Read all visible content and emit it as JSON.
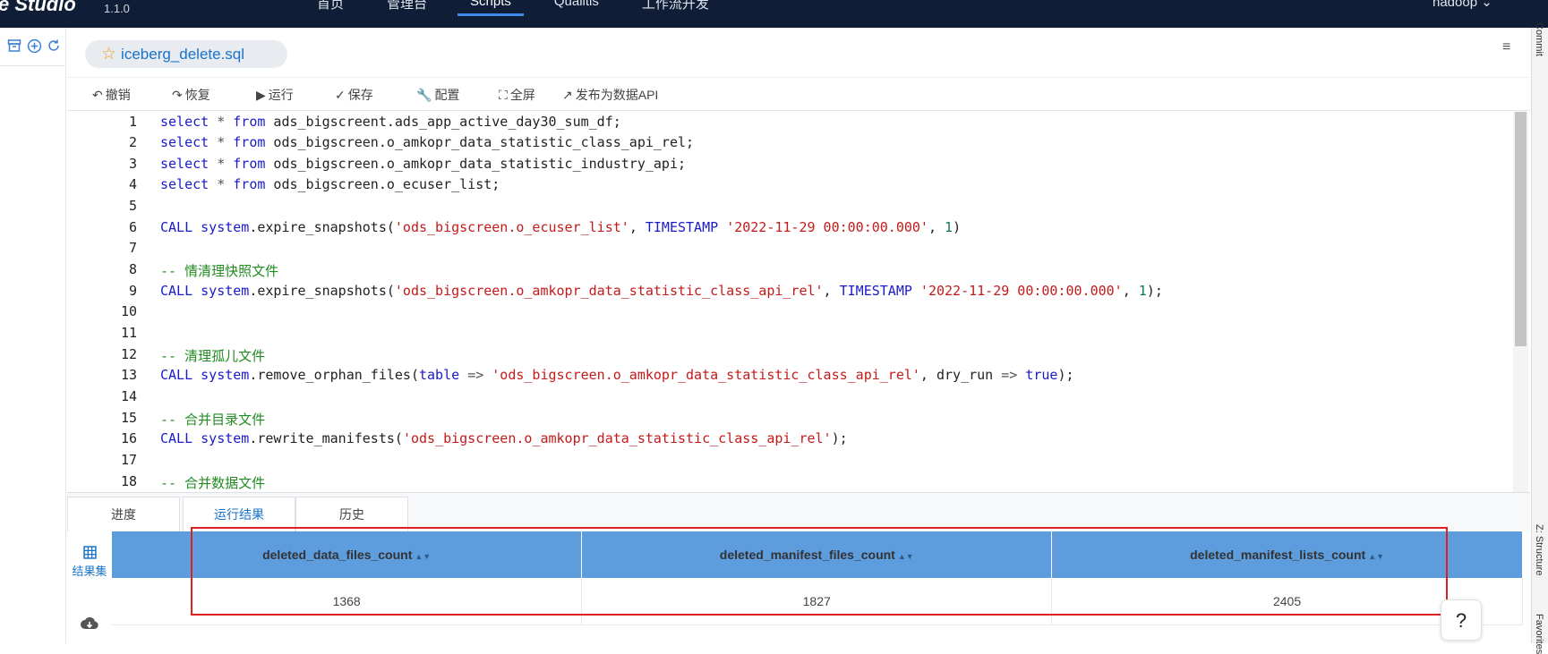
{
  "header": {
    "brand": "e Studio",
    "version": "1.1.0",
    "nav": [
      "首页",
      "管理台",
      "Scripts",
      "Qualitis",
      "工作流开发"
    ],
    "active_nav_index": 2,
    "user": "hadoop"
  },
  "left_panel": {
    "icons": [
      "archive-icon",
      "add-circle-icon",
      "refresh-icon"
    ]
  },
  "right_strip": {
    "labels": [
      "Commit",
      "Z: Structure",
      "Favorites"
    ]
  },
  "file_tab": {
    "name": "iceberg_delete.sql",
    "icon": "star-icon"
  },
  "toolbar": {
    "undo": "撤销",
    "redo": "恢复",
    "run": "运行",
    "save": "保存",
    "config": "配置",
    "fullscreen": "全屏",
    "publish": "发布为数据API"
  },
  "editor": {
    "line_numbers": [
      "1",
      "2",
      "3",
      "4",
      "5",
      "6",
      "7",
      "8",
      "9",
      "10",
      "11",
      "12",
      "13",
      "14",
      "15",
      "16",
      "17",
      "18"
    ],
    "code_lines": [
      "select * from ads_bigscreent.ads_app_active_day30_sum_df;",
      "select * from ods_bigscreen.o_amkopr_data_statistic_class_api_rel;",
      "select * from ods_bigscreen.o_amkopr_data_statistic_industry_api;",
      "select * from ods_bigscreen.o_ecuser_list;",
      "",
      "CALL system.expire_snapshots('ods_bigscreen.o_ecuser_list', TIMESTAMP '2022-11-29 00:00:00.000', 1)",
      "",
      "-- 情清理快照文件",
      "CALL system.expire_snapshots('ods_bigscreen.o_amkopr_data_statistic_class_api_rel', TIMESTAMP '2022-11-29 00:00:00.000', 1);",
      "",
      "",
      "-- 清理孤儿文件",
      "CALL system.remove_orphan_files(table => 'ods_bigscreen.o_amkopr_data_statistic_class_api_rel', dry_run => true);",
      "",
      "-- 合并目录文件",
      "CALL system.rewrite_manifests('ods_bigscreen.o_amkopr_data_statistic_class_api_rel');",
      "",
      "-- 合并数据文件"
    ]
  },
  "bottom": {
    "tabs": [
      "进度",
      "运行结果",
      "历史"
    ],
    "active_tab_index": 1,
    "side_tools": {
      "result_set": "结果集"
    },
    "columns": [
      "deleted_data_files_count",
      "deleted_manifest_files_count",
      "deleted_manifest_lists_count"
    ],
    "rows": [
      [
        "1368",
        "1827",
        "2405"
      ]
    ]
  },
  "help_label": "?"
}
